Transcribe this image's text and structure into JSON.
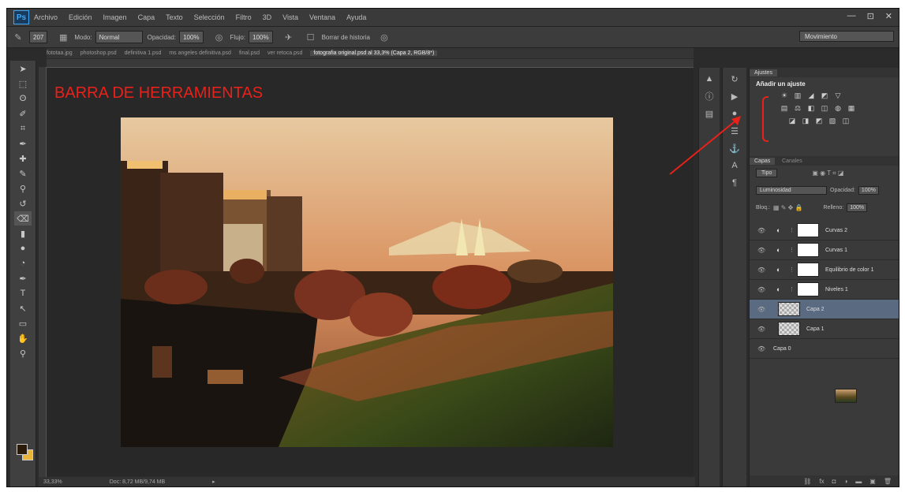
{
  "app": {
    "logo": "Ps"
  },
  "menu": [
    "Archivo",
    "Edición",
    "Imagen",
    "Capa",
    "Texto",
    "Selección",
    "Filtro",
    "3D",
    "Vista",
    "Ventana",
    "Ayuda"
  ],
  "window_controls": [
    "—",
    "⊡",
    "✕"
  ],
  "options": {
    "brush_size": "207",
    "mode_label": "Modo:",
    "mode_value": "Normal",
    "opacity_label": "Opacidad:",
    "opacity_value": "100%",
    "flow_label": "Flujo:",
    "flow_value": "100%",
    "align_label": "Borrar de historia",
    "workspace": "Movimiento"
  },
  "tabs": [
    {
      "label": "fototaa.jpg"
    },
    {
      "label": "photoshop.psd"
    },
    {
      "label": "definitiva 1.psd"
    },
    {
      "label": "ms angeles definitiva.psd"
    },
    {
      "label": "final.psd"
    },
    {
      "label": "ver retoca.psd"
    },
    {
      "label": "fotografia original.psd al 33,3% (Capa 2, RGB/8*)",
      "active": true
    }
  ],
  "annotation": {
    "text": "BARRA DE HERRAMIENTAS",
    "color": "#e8211a"
  },
  "status": {
    "zoom": "33,33%",
    "doc": "Doc: 8,72 MB/9,74 MB"
  },
  "adjustments": {
    "tab_label": "Ajustes",
    "title": "Añadir un ajuste",
    "rows": [
      [
        "☀",
        "▥",
        "◢",
        "◩",
        "▽"
      ],
      [
        "▤",
        "⚖",
        "◧",
        "◫",
        "◍",
        "▦"
      ],
      [
        "◪",
        "◨",
        "◩",
        "▧",
        "◫"
      ]
    ]
  },
  "layers": {
    "tabs": [
      "Capas",
      "Canales"
    ],
    "kind": "Tipo",
    "blend": "Luminosidad",
    "opacity_label": "Opacidad:",
    "opacity_value": "100%",
    "lock_label": "Bloq.:",
    "fill_label": "Relleno:",
    "fill_value": "100%",
    "items": [
      {
        "name": "Curvas 2",
        "thumb": "white",
        "adj": true
      },
      {
        "name": "Curvas 1",
        "thumb": "white",
        "adj": true
      },
      {
        "name": "Equilibrio de color 1",
        "thumb": "white",
        "adj": true
      },
      {
        "name": "Niveles 1",
        "thumb": "white",
        "adj": true
      },
      {
        "name": "Capa 2",
        "thumb": "check",
        "adj": false,
        "selected": true
      },
      {
        "name": "Capa 1",
        "thumb": "check",
        "adj": false
      },
      {
        "name": "Capa 0",
        "thumb": "photo",
        "adj": false
      }
    ],
    "footer": [
      "⛓",
      "fx",
      "◘",
      "◑",
      "▬",
      "▣",
      "🗑"
    ]
  },
  "colors": {
    "fg": "#2a1a0a",
    "bg": "#e8b53a",
    "accent": "#e8211a"
  }
}
